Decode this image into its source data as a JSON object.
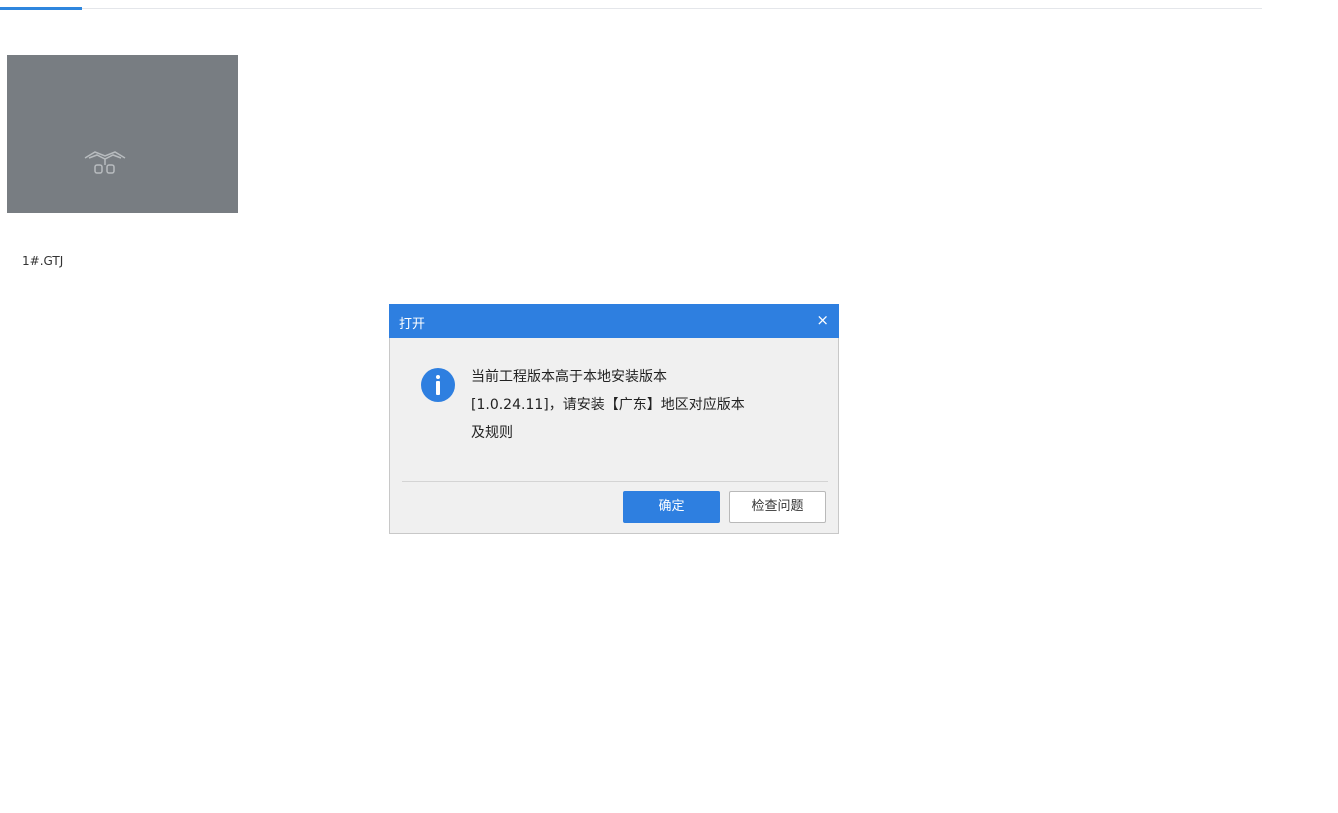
{
  "file": {
    "name": "1#.GTJ"
  },
  "dialog": {
    "title": "打开",
    "close_label": "×",
    "message_lines": [
      "当前工程版本高于本地安装版本",
      "[1.0.24.11]，请安装【广东】地区对应版本",
      "及规则"
    ],
    "ok_label": "确定",
    "check_label": "检查问题"
  },
  "colors": {
    "accent": "#2e7fe0",
    "thumbnail_bg": "#787d82",
    "dialog_bg": "#f0f0f0"
  },
  "icons": {
    "info": "info-icon",
    "close": "close-icon",
    "thumbnail": "project-thumbnail-icon"
  }
}
